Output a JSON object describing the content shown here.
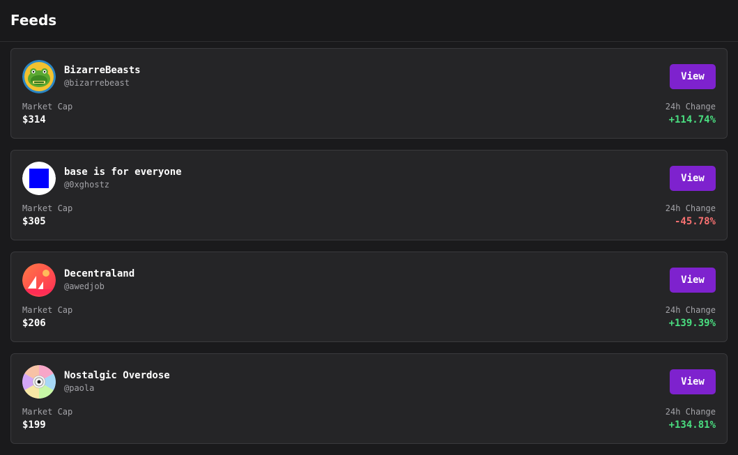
{
  "header": {
    "title": "Feeds"
  },
  "labels": {
    "market_cap": "Market Cap",
    "change_24h": "24h Change",
    "view": "View"
  },
  "colors": {
    "positive": "#4ade80",
    "negative": "#f87171",
    "accent": "#7e22ce"
  },
  "feeds": [
    {
      "name": "BizarreBeasts",
      "handle": "@bizarrebeast",
      "market_cap": "$314",
      "change": "+114.74%",
      "direction": "positive",
      "avatar_icon": "bizarrebeasts-frog-avatar-icon"
    },
    {
      "name": "base is for everyone",
      "handle": "@0xghostz",
      "market_cap": "$305",
      "change": "-45.78%",
      "direction": "negative",
      "avatar_icon": "blue-square-avatar-icon"
    },
    {
      "name": "Decentraland",
      "handle": "@awedjob",
      "market_cap": "$206",
      "change": "+139.39%",
      "direction": "positive",
      "avatar_icon": "decentraland-logo-avatar-icon"
    },
    {
      "name": "Nostalgic Overdose",
      "handle": "@paola",
      "market_cap": "$199",
      "change": "+134.81%",
      "direction": "positive",
      "avatar_icon": "compact-disc-avatar-icon"
    }
  ]
}
